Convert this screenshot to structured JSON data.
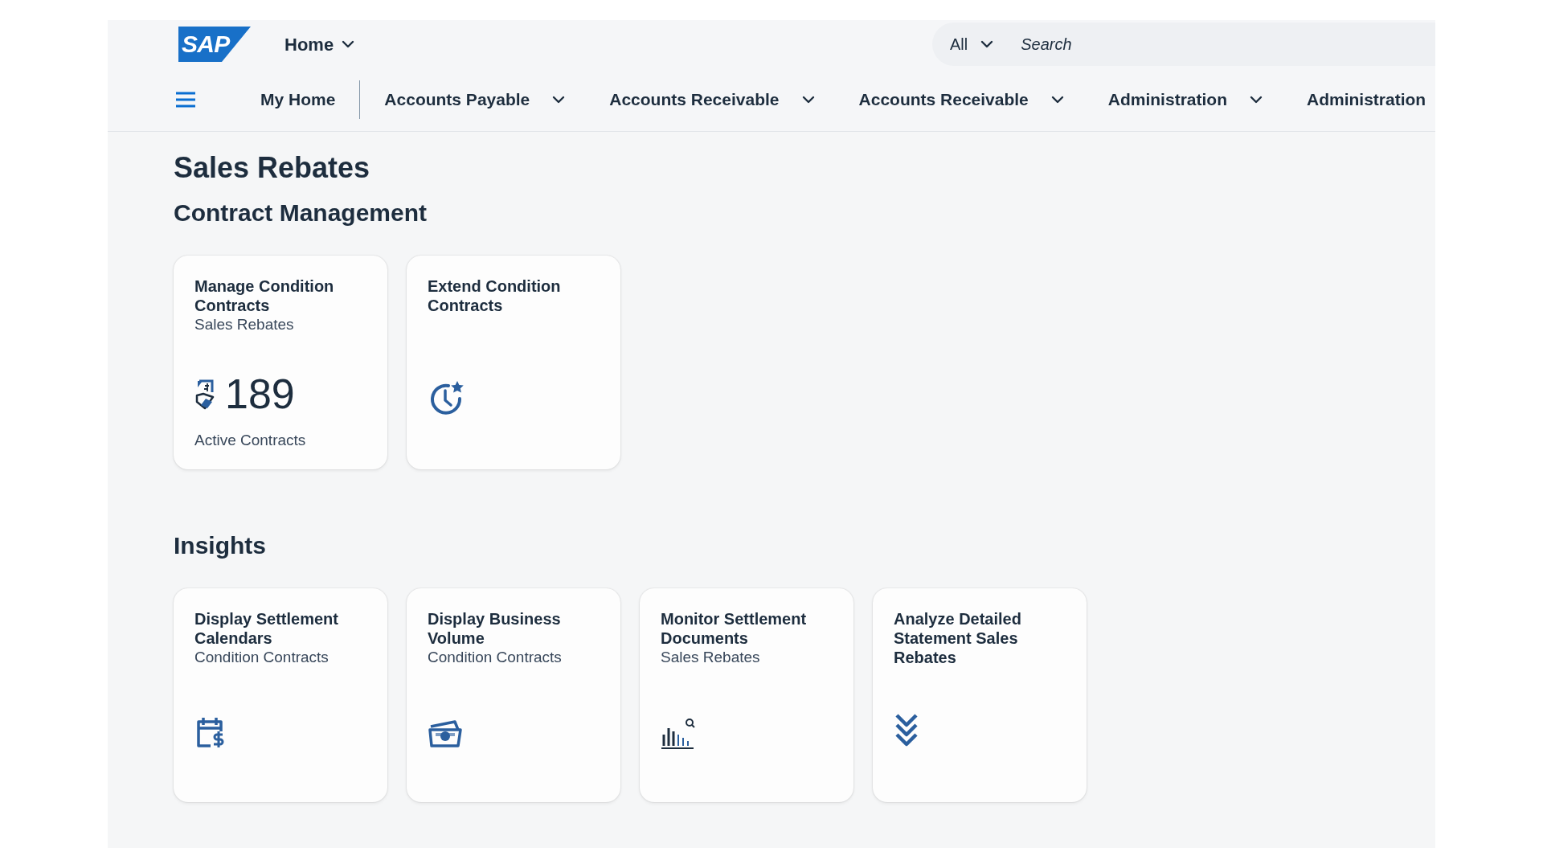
{
  "shell": {
    "logo": "SAP",
    "home_menu": "Home",
    "search_scope": "All",
    "search": {
      "placeholder": "Search"
    }
  },
  "nav": {
    "items": [
      {
        "label": "My Home",
        "has_menu": false
      },
      {
        "label": "Accounts Payable",
        "has_menu": true
      },
      {
        "label": "Accounts Receivable",
        "has_menu": true
      },
      {
        "label": "Accounts Receivable",
        "has_menu": true
      },
      {
        "label": "Administration",
        "has_menu": true
      },
      {
        "label": "Administration",
        "has_menu": false
      }
    ]
  },
  "page": {
    "title": "Sales Rebates"
  },
  "sections": [
    {
      "title": "Contract Management",
      "tiles": [
        {
          "kind": "kpi",
          "title": "Manage Condition Contracts",
          "subtitle": "Sales Rebates",
          "value": "189",
          "footer": "Active Contracts"
        },
        {
          "kind": "launch",
          "title": "Extend Condition Contracts"
        }
      ]
    },
    {
      "title": "Insights",
      "tiles": [
        {
          "kind": "launch",
          "title": "Display Settlement Calendars",
          "subtitle": "Condition Contracts"
        },
        {
          "kind": "launch",
          "title": "Display Business Volume",
          "subtitle": "Condition Contracts"
        },
        {
          "kind": "launch",
          "title": "Monitor Settlement Documents",
          "subtitle": "Sales Rebates"
        },
        {
          "kind": "launch",
          "title": "Analyze Detailed Statement Sales Rebates"
        }
      ]
    }
  ]
}
